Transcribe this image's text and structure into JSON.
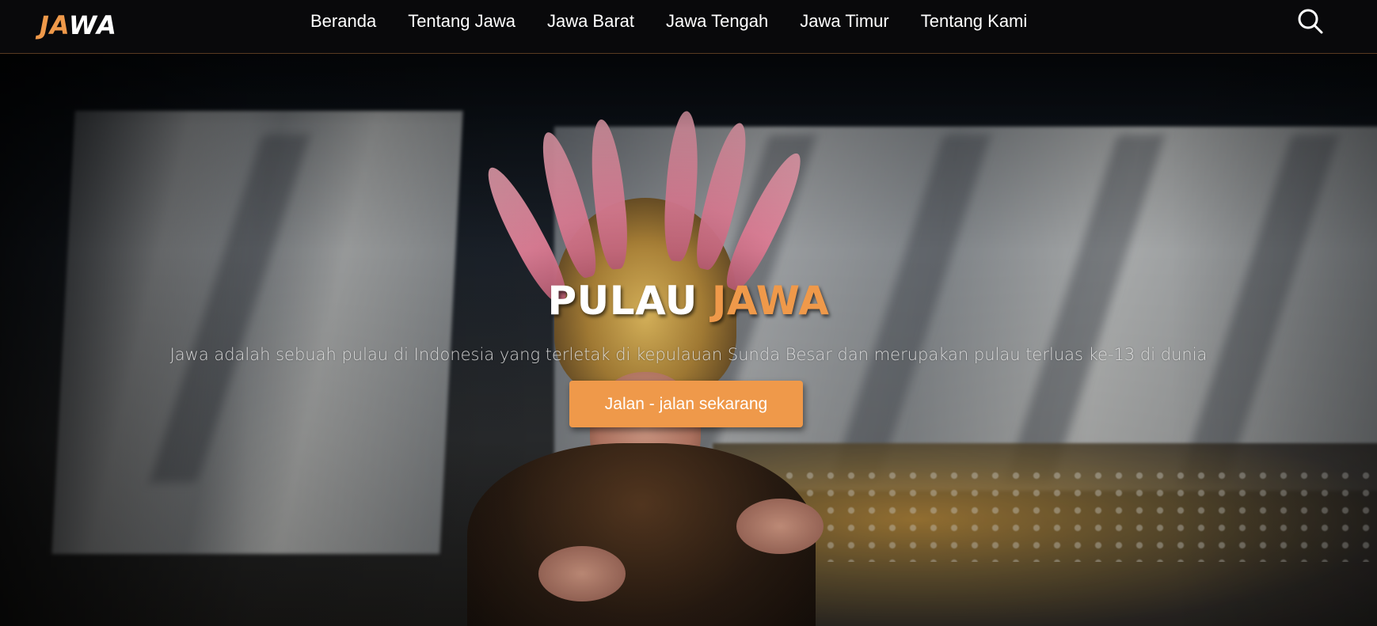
{
  "brand": {
    "logo_part1": "JA",
    "logo_part2": "WA",
    "accent_color": "#ef994a"
  },
  "nav": {
    "items": [
      {
        "label": "Beranda"
      },
      {
        "label": "Tentang Jawa"
      },
      {
        "label": "Jawa Barat"
      },
      {
        "label": "Jawa Tengah"
      },
      {
        "label": "Jawa Timur"
      },
      {
        "label": "Tentang Kami"
      }
    ],
    "search_icon": "search-icon"
  },
  "hero": {
    "title_part1": "PULAU ",
    "title_part2": "JAWA",
    "subtitle": "Jawa adalah sebuah pulau di Indonesia yang terletak di kepulauan Sunda Besar dan merupakan pulau terluas ke-13 di dunia",
    "cta_label": "Jalan - jalan sekarang",
    "background": "traditional-dancer-photo"
  }
}
